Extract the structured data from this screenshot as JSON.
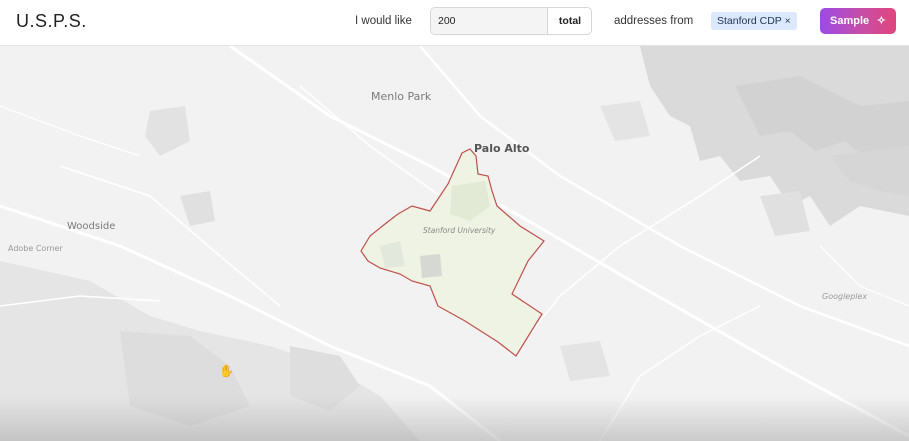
{
  "app": {
    "title": "U.S.P.S."
  },
  "query": {
    "prefix": "I would like",
    "count_value": "200",
    "count_unit": "total",
    "middle": "addresses from",
    "region_chip": "Stanford CDP",
    "chip_remove": "×"
  },
  "actions": {
    "sample_label": "Sample",
    "sample_icon": "✧"
  },
  "map": {
    "labels": {
      "menlo_park": "Menlo Park",
      "palo_alto": "Palo Alto",
      "woodside": "Woodside",
      "adobe_corner": "Adobe Corner",
      "stanford_university": "Stanford University",
      "googleplex": "Googleplex"
    },
    "colors": {
      "land": "#f2f2f2",
      "water": "#dadada",
      "park": "#e6e6e6",
      "boundary": "#c0504d",
      "region_fill": "#eef3e4"
    }
  }
}
